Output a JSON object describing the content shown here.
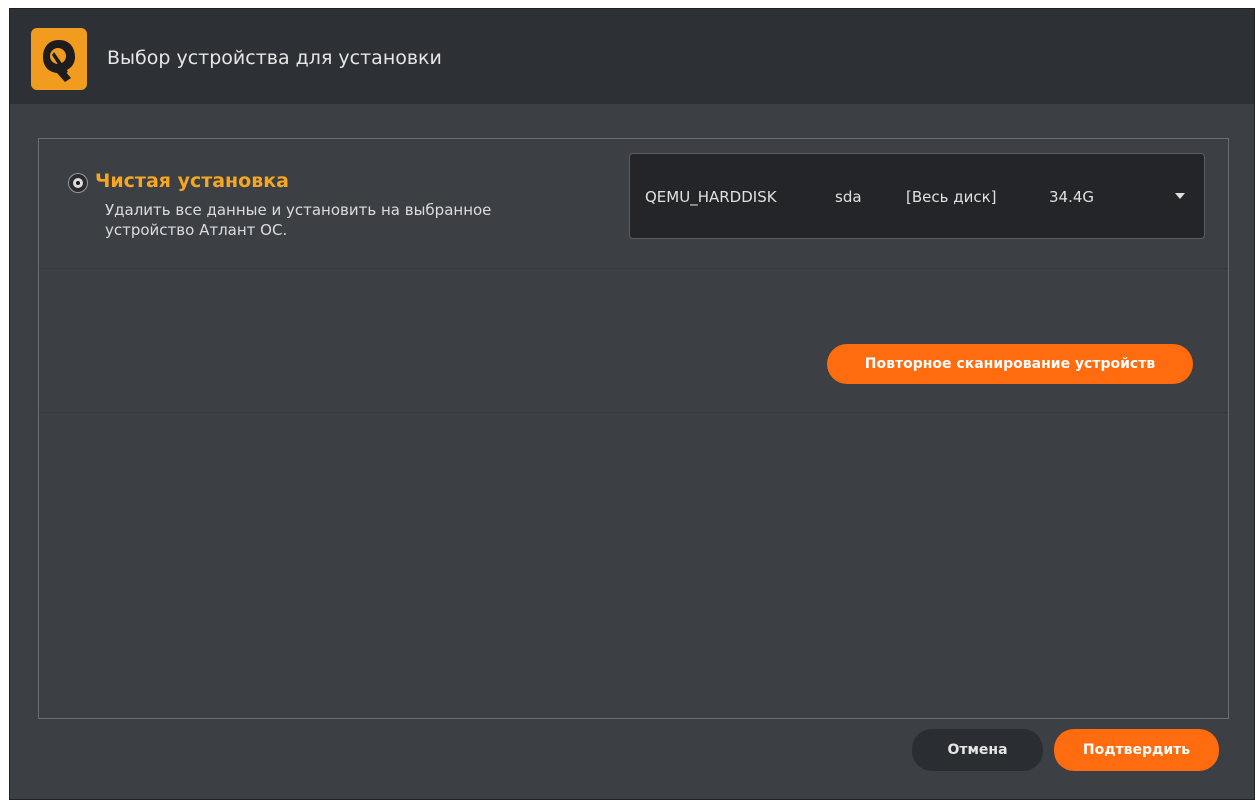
{
  "header": {
    "title": "Выбор устройства для установки",
    "logo_icon": "atlant-logo-icon"
  },
  "install_option": {
    "title": "Чистая установка",
    "description": "Удалить все данные и установить на выбранное устройство Атлант ОС.",
    "selected": true
  },
  "device_select": {
    "model": "QEMU_HARDDISK",
    "device": "sda",
    "partition": "[Весь диск]",
    "size": "34.4G",
    "icon": "chevron-down-icon"
  },
  "buttons": {
    "rescan": "Повторное сканирование устройств",
    "cancel": "Отмена",
    "confirm": "Подтвердить"
  },
  "colors": {
    "accent": "#ff6b0f",
    "option_title": "#f5a623",
    "background": "#3c3f43",
    "header": "#2d3034"
  }
}
